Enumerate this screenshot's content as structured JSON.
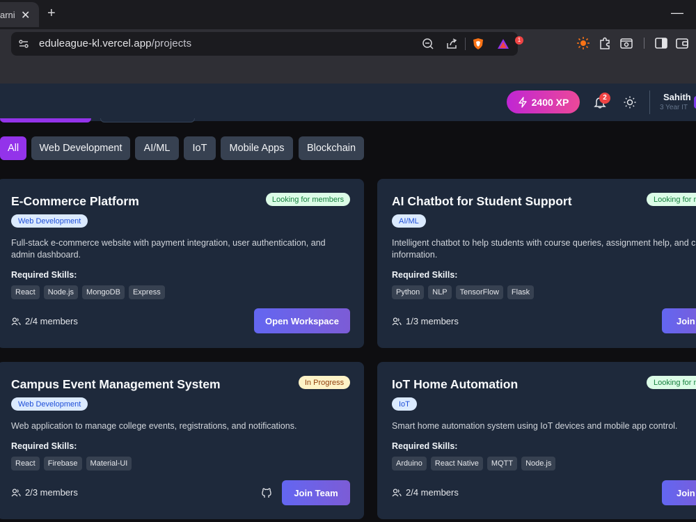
{
  "browser": {
    "tab_title": "arni",
    "url_domain": "eduleague-kl.vercel.app",
    "url_path": "/projects",
    "shield_badge": "1"
  },
  "header": {
    "xp": "2400 XP",
    "notifications_count": "2",
    "user_name": "Sahith",
    "user_subtitle": "3 Year IT"
  },
  "filters": [
    "All",
    "Web Development",
    "AI/ML",
    "IoT",
    "Mobile Apps",
    "Blockchain"
  ],
  "labels": {
    "required_skills": "Required Skills:"
  },
  "projects": [
    {
      "title": "E-Commerce Platform",
      "status": "Looking for members",
      "category": "Web Development",
      "description": "Full-stack e-commerce website with payment integration, user authentication, and admin dashboard.",
      "skills": [
        "React",
        "Node.js",
        "MongoDB",
        "Express"
      ],
      "members": "2/4 members",
      "action": "Open Workspace"
    },
    {
      "title": "AI Chatbot for Student Support",
      "status": "Looking for m",
      "category": "AI/ML",
      "description": "Intelligent chatbot to help students with course queries, assignment help, and c information.",
      "skills": [
        "Python",
        "NLP",
        "TensorFlow",
        "Flask"
      ],
      "members": "1/3 members",
      "action": "Join T"
    },
    {
      "title": "Campus Event Management System",
      "status": "In Progress",
      "category": "Web Development",
      "description": "Web application to manage college events, registrations, and notifications.",
      "skills": [
        "React",
        "Firebase",
        "Material-UI"
      ],
      "members": "2/3 members",
      "action": "Join Team"
    },
    {
      "title": "IoT Home Automation",
      "status": "Looking for m",
      "category": "IoT",
      "description": "Smart home automation system using IoT devices and mobile app control.",
      "skills": [
        "Arduino",
        "React Native",
        "MQTT",
        "Node.js"
      ],
      "members": "2/4 members",
      "action": "Join T"
    }
  ],
  "colors": {
    "accent": "#9333ea",
    "xp_gradient_start": "#c026d3",
    "xp_gradient_end": "#ec4899",
    "button_gradient_start": "#6366f1",
    "card_bg": "#1e293b"
  }
}
